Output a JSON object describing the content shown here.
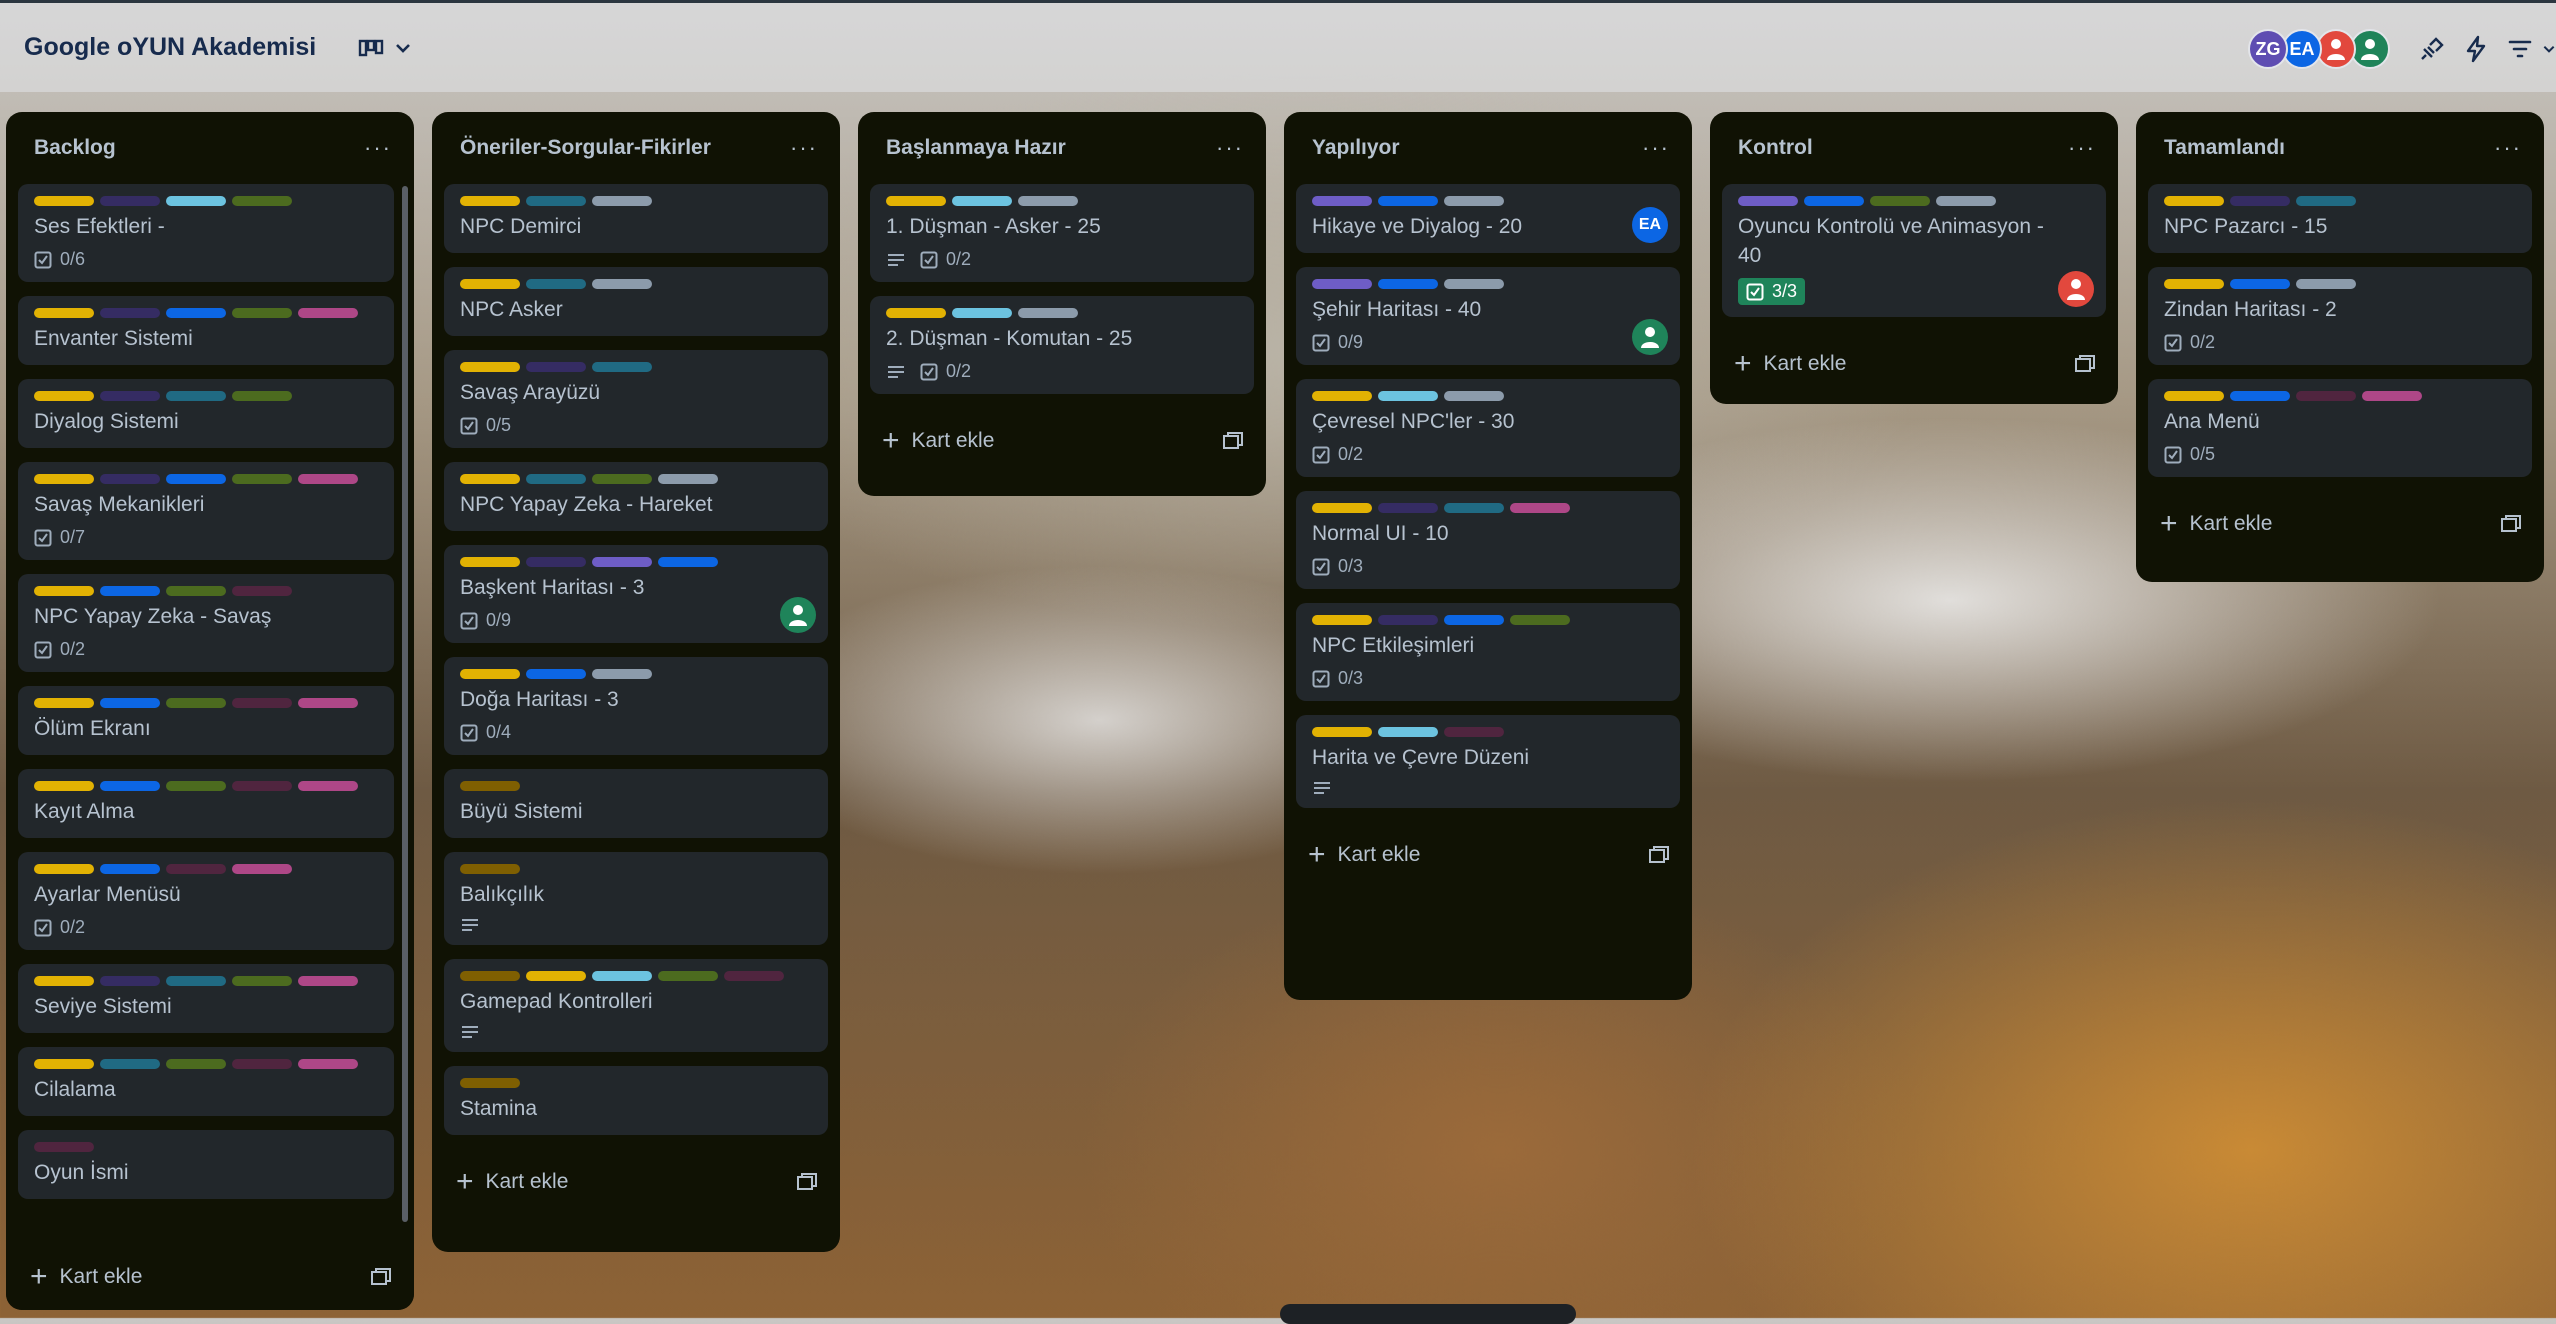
{
  "board": {
    "title": "Google oYUN Akademisi",
    "members": [
      {
        "initials": "ZG",
        "color": "#5e4db2"
      },
      {
        "initials": "EA",
        "color": "#0c66e4"
      },
      {
        "initials": "",
        "color": "#e2483d"
      },
      {
        "initials": "",
        "color": "#1f845a"
      }
    ]
  },
  "colors": {
    "yellow": "#e2b203",
    "purple": "#5e4db2",
    "sky": "#6cc3e0",
    "green": "#4c6b1f",
    "blue": "#0c66e4",
    "pink": "#ae4787",
    "teal": "#206a83",
    "gray": "#8c9bab",
    "lime": "#5b7f24",
    "maroon": "#50253f",
    "olive": "#7f5f01",
    "violet": "#6e5dc6"
  },
  "add_card_label": "Kart ekle",
  "lists": [
    {
      "title": "Backlog",
      "cards": [
        {
          "labels": [
            "#e2b203",
            "#352c63",
            "#6cc3e0",
            "#4c6b1f"
          ],
          "title": "Ses Efektleri -",
          "checklist": "0/6"
        },
        {
          "labels": [
            "#e2b203",
            "#352c63",
            "#0c66e4",
            "#4c6b1f",
            "#ae4787"
          ],
          "title": "Envanter Sistemi"
        },
        {
          "labels": [
            "#e2b203",
            "#352c63",
            "#206a83",
            "#4c6b1f"
          ],
          "title": "Diyalog Sistemi"
        },
        {
          "labels": [
            "#e2b203",
            "#352c63",
            "#0c66e4",
            "#4c6b1f",
            "#ae4787"
          ],
          "title": "Savaş Mekanikleri",
          "checklist": "0/7"
        },
        {
          "labels": [
            "#e2b203",
            "#0c66e4",
            "#4c6b1f",
            "#50253f"
          ],
          "title": "NPC Yapay Zeka - Savaş",
          "checklist": "0/2"
        },
        {
          "labels": [
            "#e2b203",
            "#0c66e4",
            "#4c6b1f",
            "#50253f",
            "#ae4787"
          ],
          "title": "Ölüm Ekranı"
        },
        {
          "labels": [
            "#e2b203",
            "#0c66e4",
            "#4c6b1f",
            "#50253f",
            "#ae4787"
          ],
          "title": "Kayıt Alma"
        },
        {
          "labels": [
            "#e2b203",
            "#0c66e4",
            "#50253f",
            "#ae4787"
          ],
          "title": "Ayarlar Menüsü",
          "checklist": "0/2"
        },
        {
          "labels": [
            "#e2b203",
            "#352c63",
            "#206a83",
            "#4c6b1f",
            "#ae4787"
          ],
          "title": "Seviye Sistemi"
        },
        {
          "labels": [
            "#e2b203",
            "#206a83",
            "#4c6b1f",
            "#50253f",
            "#ae4787"
          ],
          "title": "Cilalama"
        },
        {
          "labels": [
            "#50253f"
          ],
          "title": "Oyun İsmi"
        }
      ]
    },
    {
      "title": "Öneriler-Sorgular-Fikirler",
      "cards": [
        {
          "labels": [
            "#e2b203",
            "#206a83",
            "#8c9bab"
          ],
          "title": "NPC Demirci"
        },
        {
          "labels": [
            "#e2b203",
            "#206a83",
            "#8c9bab"
          ],
          "title": "NPC Asker"
        },
        {
          "labels": [
            "#e2b203",
            "#352c63",
            "#206a83"
          ],
          "title": "Savaş Arayüzü",
          "checklist": "0/5"
        },
        {
          "labels": [
            "#e2b203",
            "#206a83",
            "#4c6b1f",
            "#8c9bab"
          ],
          "title": "NPC Yapay Zeka - Hareket"
        },
        {
          "labels": [
            "#e2b203",
            "#352c63",
            "#6e5dc6",
            "#0c66e4"
          ],
          "title": "Başkent Haritası - 3",
          "checklist": "0/9",
          "member": "green"
        },
        {
          "labels": [
            "#e2b203",
            "#0c66e4",
            "#8c9bab"
          ],
          "title": "Doğa Haritası - 3",
          "checklist": "0/4"
        },
        {
          "labels": [
            "#7f5f01"
          ],
          "title": "Büyü Sistemi"
        },
        {
          "labels": [
            "#7f5f01"
          ],
          "title": "Balıkçılık",
          "description": true
        },
        {
          "labels": [
            "#7f5f01",
            "#e2b203",
            "#6cc3e0",
            "#4c6b1f",
            "#50253f"
          ],
          "title": "Gamepad Kontrolleri",
          "description": true
        },
        {
          "labels": [
            "#7f5f01"
          ],
          "title": "Stamina"
        }
      ]
    },
    {
      "title": "Başlanmaya Hazır",
      "cards": [
        {
          "labels": [
            "#e2b203",
            "#6cc3e0",
            "#8c9bab"
          ],
          "title": "1. Düşman - Asker - 25",
          "description": true,
          "checklist": "0/2"
        },
        {
          "labels": [
            "#e2b203",
            "#6cc3e0",
            "#8c9bab"
          ],
          "title": "2. Düşman - Komutan - 25",
          "description": true,
          "checklist": "0/2"
        }
      ]
    },
    {
      "title": "Yapılıyor",
      "cards": [
        {
          "labels": [
            "#6e5dc6",
            "#0c66e4",
            "#8c9bab"
          ],
          "title": "Hikaye ve Diyalog - 20",
          "member": "EA"
        },
        {
          "labels": [
            "#6e5dc6",
            "#0c66e4",
            "#8c9bab"
          ],
          "title": "Şehir Haritası - 40",
          "checklist": "0/9",
          "member": "green"
        },
        {
          "labels": [
            "#e2b203",
            "#6cc3e0",
            "#8c9bab"
          ],
          "title": "Çevresel NPC'ler - 30",
          "checklist": "0/2"
        },
        {
          "labels": [
            "#e2b203",
            "#352c63",
            "#206a83",
            "#ae4787"
          ],
          "title": "Normal UI - 10",
          "checklist": "0/3"
        },
        {
          "labels": [
            "#e2b203",
            "#352c63",
            "#0c66e4",
            "#4c6b1f"
          ],
          "title": "NPC Etkileşimleri",
          "checklist": "0/3"
        },
        {
          "labels": [
            "#e2b203",
            "#6cc3e0",
            "#50253f"
          ],
          "title": "Harita ve Çevre Düzeni",
          "description": true
        }
      ]
    },
    {
      "title": "Kontrol",
      "cards": [
        {
          "labels": [
            "#6e5dc6",
            "#0c66e4",
            "#4c6b1f",
            "#8c9bab"
          ],
          "title": "Oyuncu Kontrolü ve Animasyon - 40",
          "checklist": "3/3",
          "done": true,
          "member": "red"
        }
      ]
    },
    {
      "title": "Tamamlandı",
      "cards": [
        {
          "labels": [
            "#e2b203",
            "#352c63",
            "#206a83"
          ],
          "title": "NPC Pazarcı - 15"
        },
        {
          "labels": [
            "#e2b203",
            "#0c66e4",
            "#8c9bab"
          ],
          "title": "Zindan Haritası - 2",
          "checklist": "0/2"
        },
        {
          "labels": [
            "#e2b203",
            "#0c66e4",
            "#50253f",
            "#ae4787"
          ],
          "title": "Ana Menü",
          "checklist": "0/5"
        }
      ]
    }
  ]
}
